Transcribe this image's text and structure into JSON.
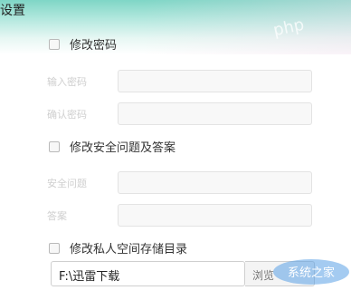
{
  "window": {
    "title": "设置"
  },
  "watermark": {
    "top_text": "php",
    "logo_text": "系统之家"
  },
  "section_password": {
    "checkbox_label": "修改密码",
    "fields": [
      {
        "label": "输入密码",
        "value": ""
      },
      {
        "label": "确认密码",
        "value": ""
      }
    ]
  },
  "section_security": {
    "checkbox_label": "修改安全问题及答案",
    "fields": [
      {
        "label": "安全问题",
        "value": ""
      },
      {
        "label": "答案",
        "value": ""
      }
    ]
  },
  "section_storage": {
    "checkbox_label": "修改私人空间存储目录",
    "path_value": "F:\\迅雷下载",
    "browse_label": "浏览"
  },
  "colors": {
    "header_teal": "#7fd6c6",
    "input_bg": "#f8f8f8",
    "border": "#cfcfcf"
  }
}
